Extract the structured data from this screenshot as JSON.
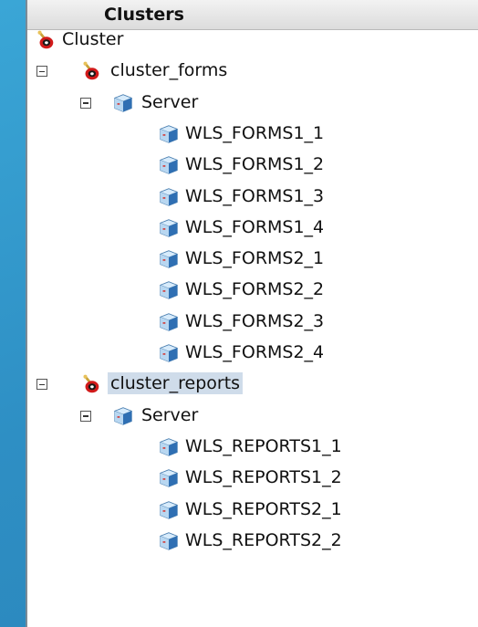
{
  "panel": {
    "title": "Clusters"
  },
  "tree": {
    "root": {
      "label": "Cluster"
    },
    "cluster_forms": {
      "label": "cluster_forms",
      "server_group": "Server",
      "servers": [
        "WLS_FORMS1_1",
        "WLS_FORMS1_2",
        "WLS_FORMS1_3",
        "WLS_FORMS1_4",
        "WLS_FORMS2_1",
        "WLS_FORMS2_2",
        "WLS_FORMS2_3",
        "WLS_FORMS2_4"
      ]
    },
    "cluster_reports": {
      "label": "cluster_reports",
      "server_group": "Server",
      "servers": [
        "WLS_REPORTS1_1",
        "WLS_REPORTS1_2",
        "WLS_REPORTS2_1",
        "WLS_REPORTS2_2"
      ]
    }
  },
  "icons": {
    "cluster": "cluster-icon",
    "server": "server-cube-icon",
    "expander": "collapse-minus-icon"
  },
  "colors": {
    "background": "#2e8fc4",
    "selection": "#cfdcea"
  }
}
